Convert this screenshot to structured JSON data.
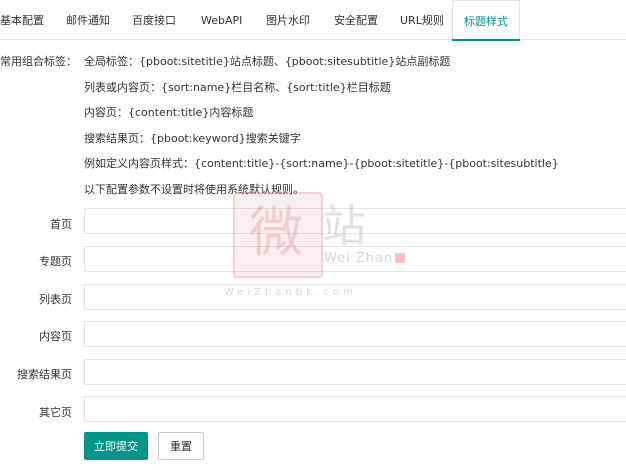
{
  "tabs": [
    {
      "label": "基本配置"
    },
    {
      "label": "邮件通知"
    },
    {
      "label": "百度接口"
    },
    {
      "label": "WebAPI"
    },
    {
      "label": "图片水印"
    },
    {
      "label": "安全配置"
    },
    {
      "label": "URL规则"
    },
    {
      "label": "标题样式",
      "active": true
    }
  ],
  "help": {
    "label": "常用组合标签：",
    "lines": [
      "全局标签：{pboot:sitetitle}站点标题、{pboot:sitesubtitle}站点副标题",
      "列表或内容页：{sort:name}栏目名称、{sort:title}栏目标题",
      "内容页：{content:title}内容标题",
      "搜索结果页：{pboot:keyword}搜索关键字",
      "例如定义内容页样式：{content:title}-{sort:name}-{pboot:sitetitle}-{pboot:sitesubtitle}",
      "以下配置参数不设置时将使用系统默认规则。"
    ]
  },
  "form": {
    "rows": [
      {
        "label": "首页",
        "value": ""
      },
      {
        "label": "专题页",
        "value": ""
      },
      {
        "label": "列表页",
        "value": ""
      },
      {
        "label": "内容页",
        "value": ""
      },
      {
        "label": "搜索结果页",
        "value": ""
      },
      {
        "label": "其它页",
        "value": ""
      }
    ],
    "submit_label": "立即提交",
    "reset_label": "重置"
  },
  "watermark": {
    "seal_char": "微",
    "char": "站",
    "en": "Wei Zhan",
    "url": "WeiZhanbk.com"
  },
  "colors": {
    "accent": "#009688",
    "border": "#e6e6e6",
    "text": "#333333"
  }
}
